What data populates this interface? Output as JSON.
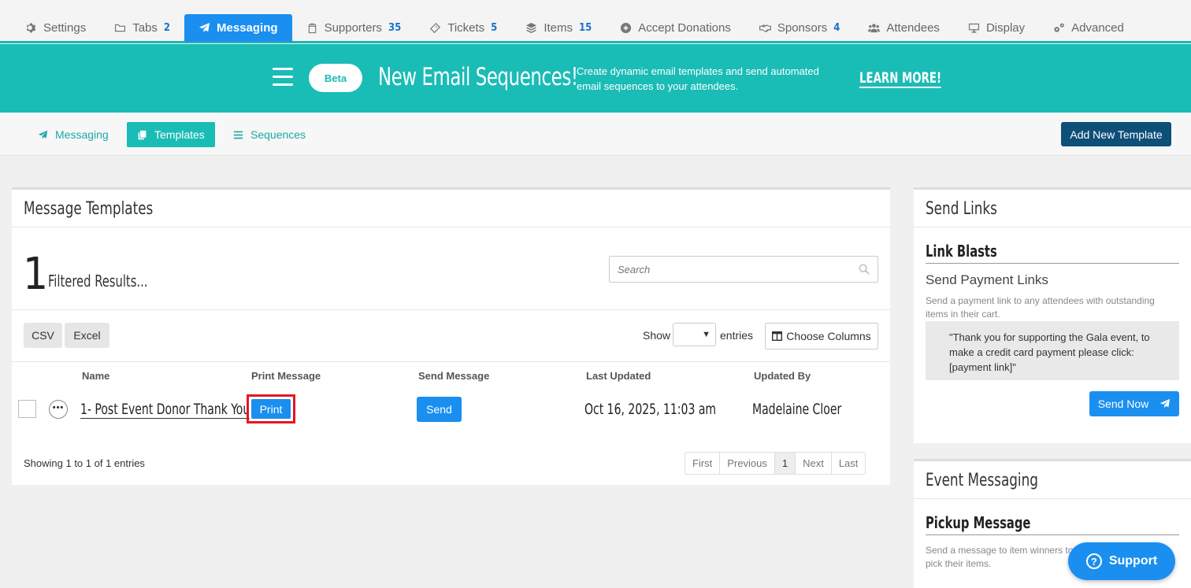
{
  "tabs": [
    {
      "label": "Settings",
      "count": "",
      "icon": "gear-icon"
    },
    {
      "label": "Tabs",
      "count": "2",
      "icon": "folder-icon"
    },
    {
      "label": "Messaging",
      "count": "",
      "icon": "paper-plane-icon",
      "active": true
    },
    {
      "label": "Supporters",
      "count": "35",
      "icon": "clipboard-icon"
    },
    {
      "label": "Tickets",
      "count": "5",
      "icon": "ticket-icon"
    },
    {
      "label": "Items",
      "count": "15",
      "icon": "layers-icon"
    },
    {
      "label": "Accept Donations",
      "count": "",
      "icon": "plus-circle-icon"
    },
    {
      "label": "Sponsors",
      "count": "4",
      "icon": "handshake-icon"
    },
    {
      "label": "Attendees",
      "count": "",
      "icon": "users-icon"
    },
    {
      "label": "Display",
      "count": "",
      "icon": "monitor-icon"
    },
    {
      "label": "Advanced",
      "count": "",
      "icon": "gears-icon"
    }
  ],
  "banner": {
    "badge": "Beta",
    "title": "New Email Sequences!",
    "description": "Create dynamic email templates and send automated email sequences to your attendees.",
    "cta": "LEARN MORE!"
  },
  "subnav": {
    "messaging": "Messaging",
    "templates": "Templates",
    "sequences": "Sequences",
    "add_button": "Add New Template"
  },
  "templates_panel": {
    "title": "Message Templates",
    "result_count": "1",
    "result_label": "Filtered Results...",
    "search_placeholder": "Search",
    "csv": "CSV",
    "excel": "Excel",
    "show": "Show",
    "show_value": "",
    "entries": "entries",
    "choose_columns": "Choose Columns",
    "headers": {
      "name": "Name",
      "print": "Print Message",
      "send": "Send Message",
      "updated": "Last Updated",
      "by": "Updated By"
    },
    "rows": [
      {
        "name": "1- Post Event Donor Thank You",
        "print_label": "Print",
        "send_label": "Send",
        "more": "•••",
        "last_updated": "Oct 16, 2025, 11:03 am",
        "updated_by": "Madelaine Cloer"
      }
    ],
    "showing": "Showing 1 to 1 of 1 entries",
    "pager": {
      "first": "First",
      "previous": "Previous",
      "current": "1",
      "next": "Next",
      "last": "Last"
    }
  },
  "send_links": {
    "title": "Send Links",
    "subtitle": "Link Blasts",
    "heading": "Send Payment Links",
    "description": "Send a payment link to any attendees with outstanding items in their cart.",
    "quote": "\"Thank you for supporting the Gala event, to make a credit card payment please click: [payment link]\"",
    "send_now": "Send Now"
  },
  "event_messaging": {
    "title": "Event Messaging",
    "subtitle": "Pickup Message",
    "description": "Send a message to item winners to pick their items."
  },
  "support": {
    "label": "Support",
    "glyph": "?"
  },
  "colors": {
    "teal": "#1abcb6",
    "blue": "#1a8ff0",
    "navy": "#0e4f78",
    "highlight": "#e8141e"
  }
}
